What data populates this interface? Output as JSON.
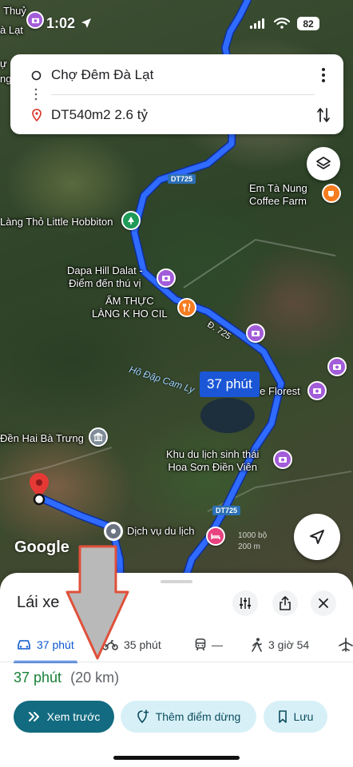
{
  "status_bar": {
    "time": "1:02",
    "battery": "82"
  },
  "route": {
    "origin": "Chợ Đêm Đà Lạt",
    "destination": "DT540m2 2.6 tỷ"
  },
  "map": {
    "labels": {
      "top_left_1": "Thuỷ",
      "top_left_2": "à Lạt",
      "top_left_3": "ự",
      "top_left_4": "ng",
      "hobbiton": "Làng Thỏ Little Hobbiton",
      "coffee": "Em Tà Nung\nCoffee Farm",
      "dapa": "Dapa Hill Dalat -\nĐiểm đến thú vị",
      "am_thuc": "ẨM THỰC\nLÀNG K HO CIL",
      "florest": "The Florest",
      "hai_ba_trung": "Đền Hai Bà Trưng",
      "khu_du_lich": "Khu du lịch sinh thái\nHoa Sơn Điền Viên",
      "dich_vu": "Dịch vụ du lịch",
      "lake": "Hồ Đập Cam Ly"
    },
    "road_shields": {
      "top": "DT725",
      "bottom": "DT725"
    },
    "road_name": "Đ. 725",
    "duration_bubble": "37 phút",
    "logo": "Google",
    "scale": {
      "feet": "1000 bộ",
      "meters": "200 m"
    }
  },
  "sheet": {
    "title": "Lái xe",
    "modes": [
      {
        "label": "37 phút",
        "icon": "car-icon",
        "active": true
      },
      {
        "label": "35 phút",
        "icon": "motorbike-icon",
        "active": false
      },
      {
        "label": "—",
        "icon": "transit-icon",
        "active": false
      },
      {
        "label": "3 giờ 54",
        "icon": "walk-icon",
        "active": false
      }
    ],
    "summary": {
      "time": "37 phút",
      "distance": "(20 km)"
    },
    "actions": {
      "preview": "Xem trước",
      "add_stop": "Thêm điểm dừng",
      "save": "Lưu"
    }
  },
  "colors": {
    "route": "#2f6bff",
    "primary_button": "#126b80",
    "secondary_button": "#d7f0f7",
    "active_tab": "#0b57d0",
    "time_green": "#188038",
    "annotation_arrow": "#e0503a"
  }
}
